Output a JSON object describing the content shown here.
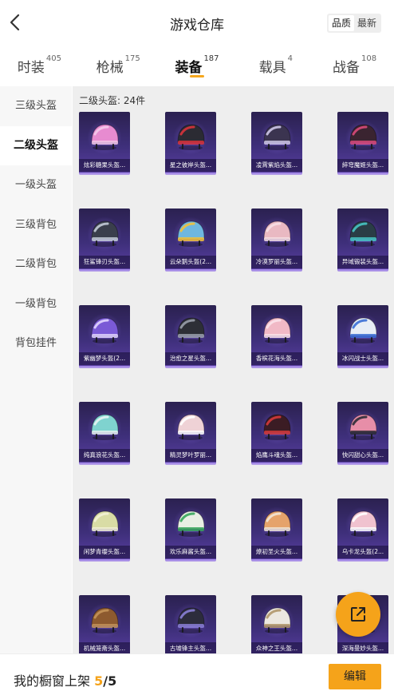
{
  "header": {
    "title": "游戏仓库",
    "back_icon": "chevron-left-icon",
    "sort_options": [
      {
        "label": "品质",
        "active": true
      },
      {
        "label": "最新",
        "active": false
      }
    ]
  },
  "tabs": [
    {
      "label": "时装",
      "count": "405",
      "active": false
    },
    {
      "label": "枪械",
      "count": "175",
      "active": false
    },
    {
      "label": "装备",
      "count": "187",
      "active": true
    },
    {
      "label": "载具",
      "count": "4",
      "active": false
    },
    {
      "label": "战备",
      "count": "108",
      "active": false
    }
  ],
  "sidebar": {
    "items": [
      {
        "label": "三级头盔",
        "active": false
      },
      {
        "label": "二级头盔",
        "active": true
      },
      {
        "label": "一级头盔",
        "active": false
      },
      {
        "label": "三级背包",
        "active": false
      },
      {
        "label": "二级背包",
        "active": false
      },
      {
        "label": "一级背包",
        "active": false
      },
      {
        "label": "背包挂件",
        "active": false
      }
    ]
  },
  "main": {
    "count_label": "二级头盔: 24件",
    "items": [
      {
        "name": "炫彩糖果头盔...",
        "color": "#e78bd0",
        "accent": "#f5c9ea"
      },
      {
        "name": "星之彼岸头盔...",
        "color": "#2b2b33",
        "accent": "#d8333b"
      },
      {
        "name": "凌霄紫焰头盔...",
        "color": "#3b3450",
        "accent": "#cfc8e8"
      },
      {
        "name": "綷穹魔姬头盔...",
        "color": "#3a2430",
        "accent": "#d94a7a"
      },
      {
        "name": "狂鲨锋刃头盔...",
        "color": "#3a3f4c",
        "accent": "#c4ccd8"
      },
      {
        "name": "云朵鹅头盔(2...",
        "color": "#6fb7e0",
        "accent": "#f3c23a"
      },
      {
        "name": "冷漠罗丽头盔...",
        "color": "#e9b9c2",
        "accent": "#f6dfe4"
      },
      {
        "name": "异域锻装头盔...",
        "color": "#2a3d46",
        "accent": "#47c6c4"
      },
      {
        "name": "紫幽梦头盔(2...",
        "color": "#7a5ad6",
        "accent": "#e2d6ff"
      },
      {
        "name": "治愈之星头盔...",
        "color": "#2d2f36",
        "accent": "#9aa0ab"
      },
      {
        "name": "香槟花海头盔...",
        "color": "#f1b9c6",
        "accent": "#fbe3ea"
      },
      {
        "name": "冰闪战士头盔...",
        "color": "#e8eef6",
        "accent": "#3b6fd6"
      },
      {
        "name": "纯真浪花头盔...",
        "color": "#7fd3cf",
        "accent": "#e7f5f2"
      },
      {
        "name": "精灵梦叶罗丽...",
        "color": "#efd2d6",
        "accent": "#ffffff"
      },
      {
        "name": "焰鹰斗魂头盔...",
        "color": "#3b1c24",
        "accent": "#d53a3a"
      },
      {
        "name": "快闪甜心头盔...",
        "color": "#e78ea8",
        "accent": "#2c2c35"
      },
      {
        "name": "闲梦青缨头盔...",
        "color": "#d9dca5",
        "accent": "#f2f1d5"
      },
      {
        "name": "欢乐麻酱头盔...",
        "color": "#e9efe4",
        "accent": "#36a65a"
      },
      {
        "name": "燎初圣火头盔...",
        "color": "#e5a36b",
        "accent": "#f1e6d7"
      },
      {
        "name": "乌卡龙头盔(2...",
        "color": "#f0c2cf",
        "accent": "#ffffff"
      },
      {
        "name": "机械笼斋头盔...",
        "color": "#8d5a2f",
        "accent": "#c49359"
      },
      {
        "name": "古墟锋主头盔...",
        "color": "#2c2c3c",
        "accent": "#8a7fd6"
      },
      {
        "name": "众神之王头盔...",
        "color": "#ece8e0",
        "accent": "#b1976a"
      },
      {
        "name": "深海曼妙头盔...",
        "color": "#6fb8d8",
        "accent": "#e8c86a"
      }
    ]
  },
  "fab_icon": "external-link-icon",
  "bottom": {
    "shelf_label": "我的橱窗上架",
    "shelf_current": "5",
    "shelf_sep": "/",
    "shelf_total": "5",
    "edit_label": "编辑"
  },
  "colors": {
    "accent": "#f5a31a",
    "card_bg": "#3e2f7a"
  }
}
